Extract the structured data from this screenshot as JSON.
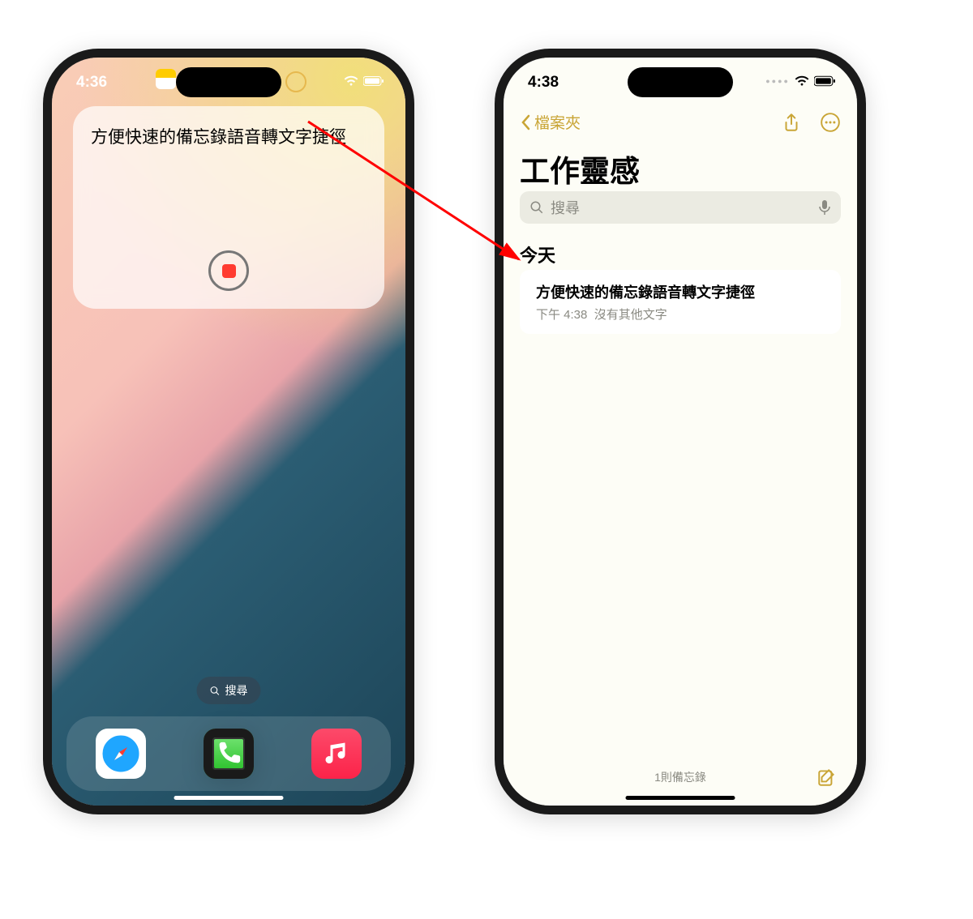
{
  "left_phone": {
    "status_time": "4:36",
    "widget_title": "方便快速的備忘錄語音轉文字捷徑",
    "search_label": "搜尋",
    "dock": {
      "phone": "phone-app",
      "safari": "safari-app",
      "messages": "messages-app",
      "music": "music-app"
    }
  },
  "right_phone": {
    "status_time": "4:38",
    "back_label": "檔案夾",
    "title": "工作靈感",
    "search_placeholder": "搜尋",
    "section_today": "今天",
    "note": {
      "title": "方便快速的備忘錄語音轉文字捷徑",
      "time": "下午 4:38",
      "preview": "沒有其他文字"
    },
    "footer_count": "1則備忘錄"
  }
}
